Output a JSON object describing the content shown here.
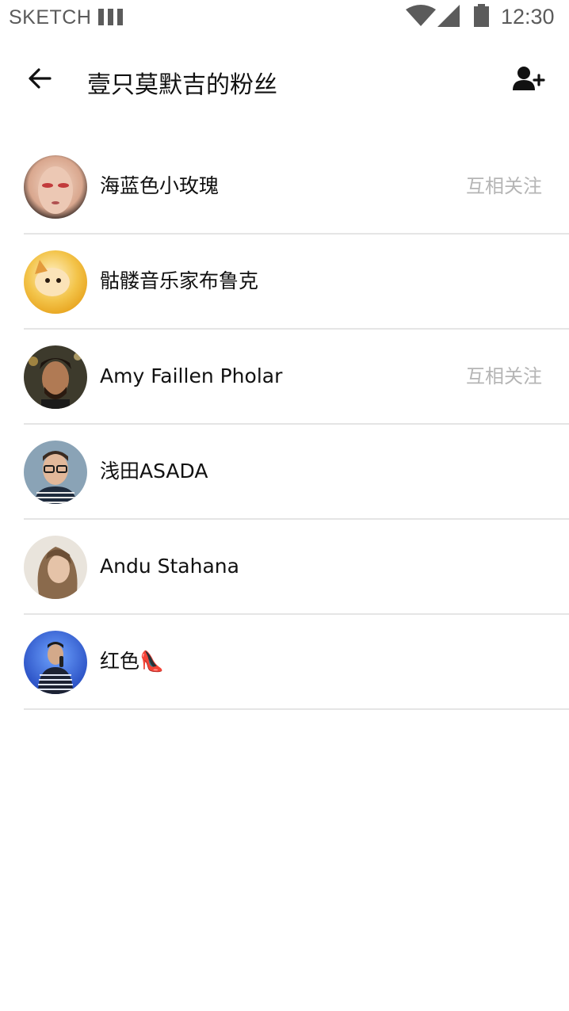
{
  "status_bar": {
    "carrier": "SKETCH",
    "time": "12:30"
  },
  "app_bar": {
    "title": "壹只莫默吉的粉丝"
  },
  "fans": [
    {
      "name": "海蓝色小玫瑰",
      "badge": "互相关注"
    },
    {
      "name": "骷髅音乐家布鲁克",
      "badge": ""
    },
    {
      "name": "Amy Faillen Pholar",
      "badge": "互相关注"
    },
    {
      "name": "浅田ASADA",
      "badge": ""
    },
    {
      "name": "Andu Stahana",
      "badge": ""
    },
    {
      "name": "红色👠",
      "badge": ""
    }
  ]
}
